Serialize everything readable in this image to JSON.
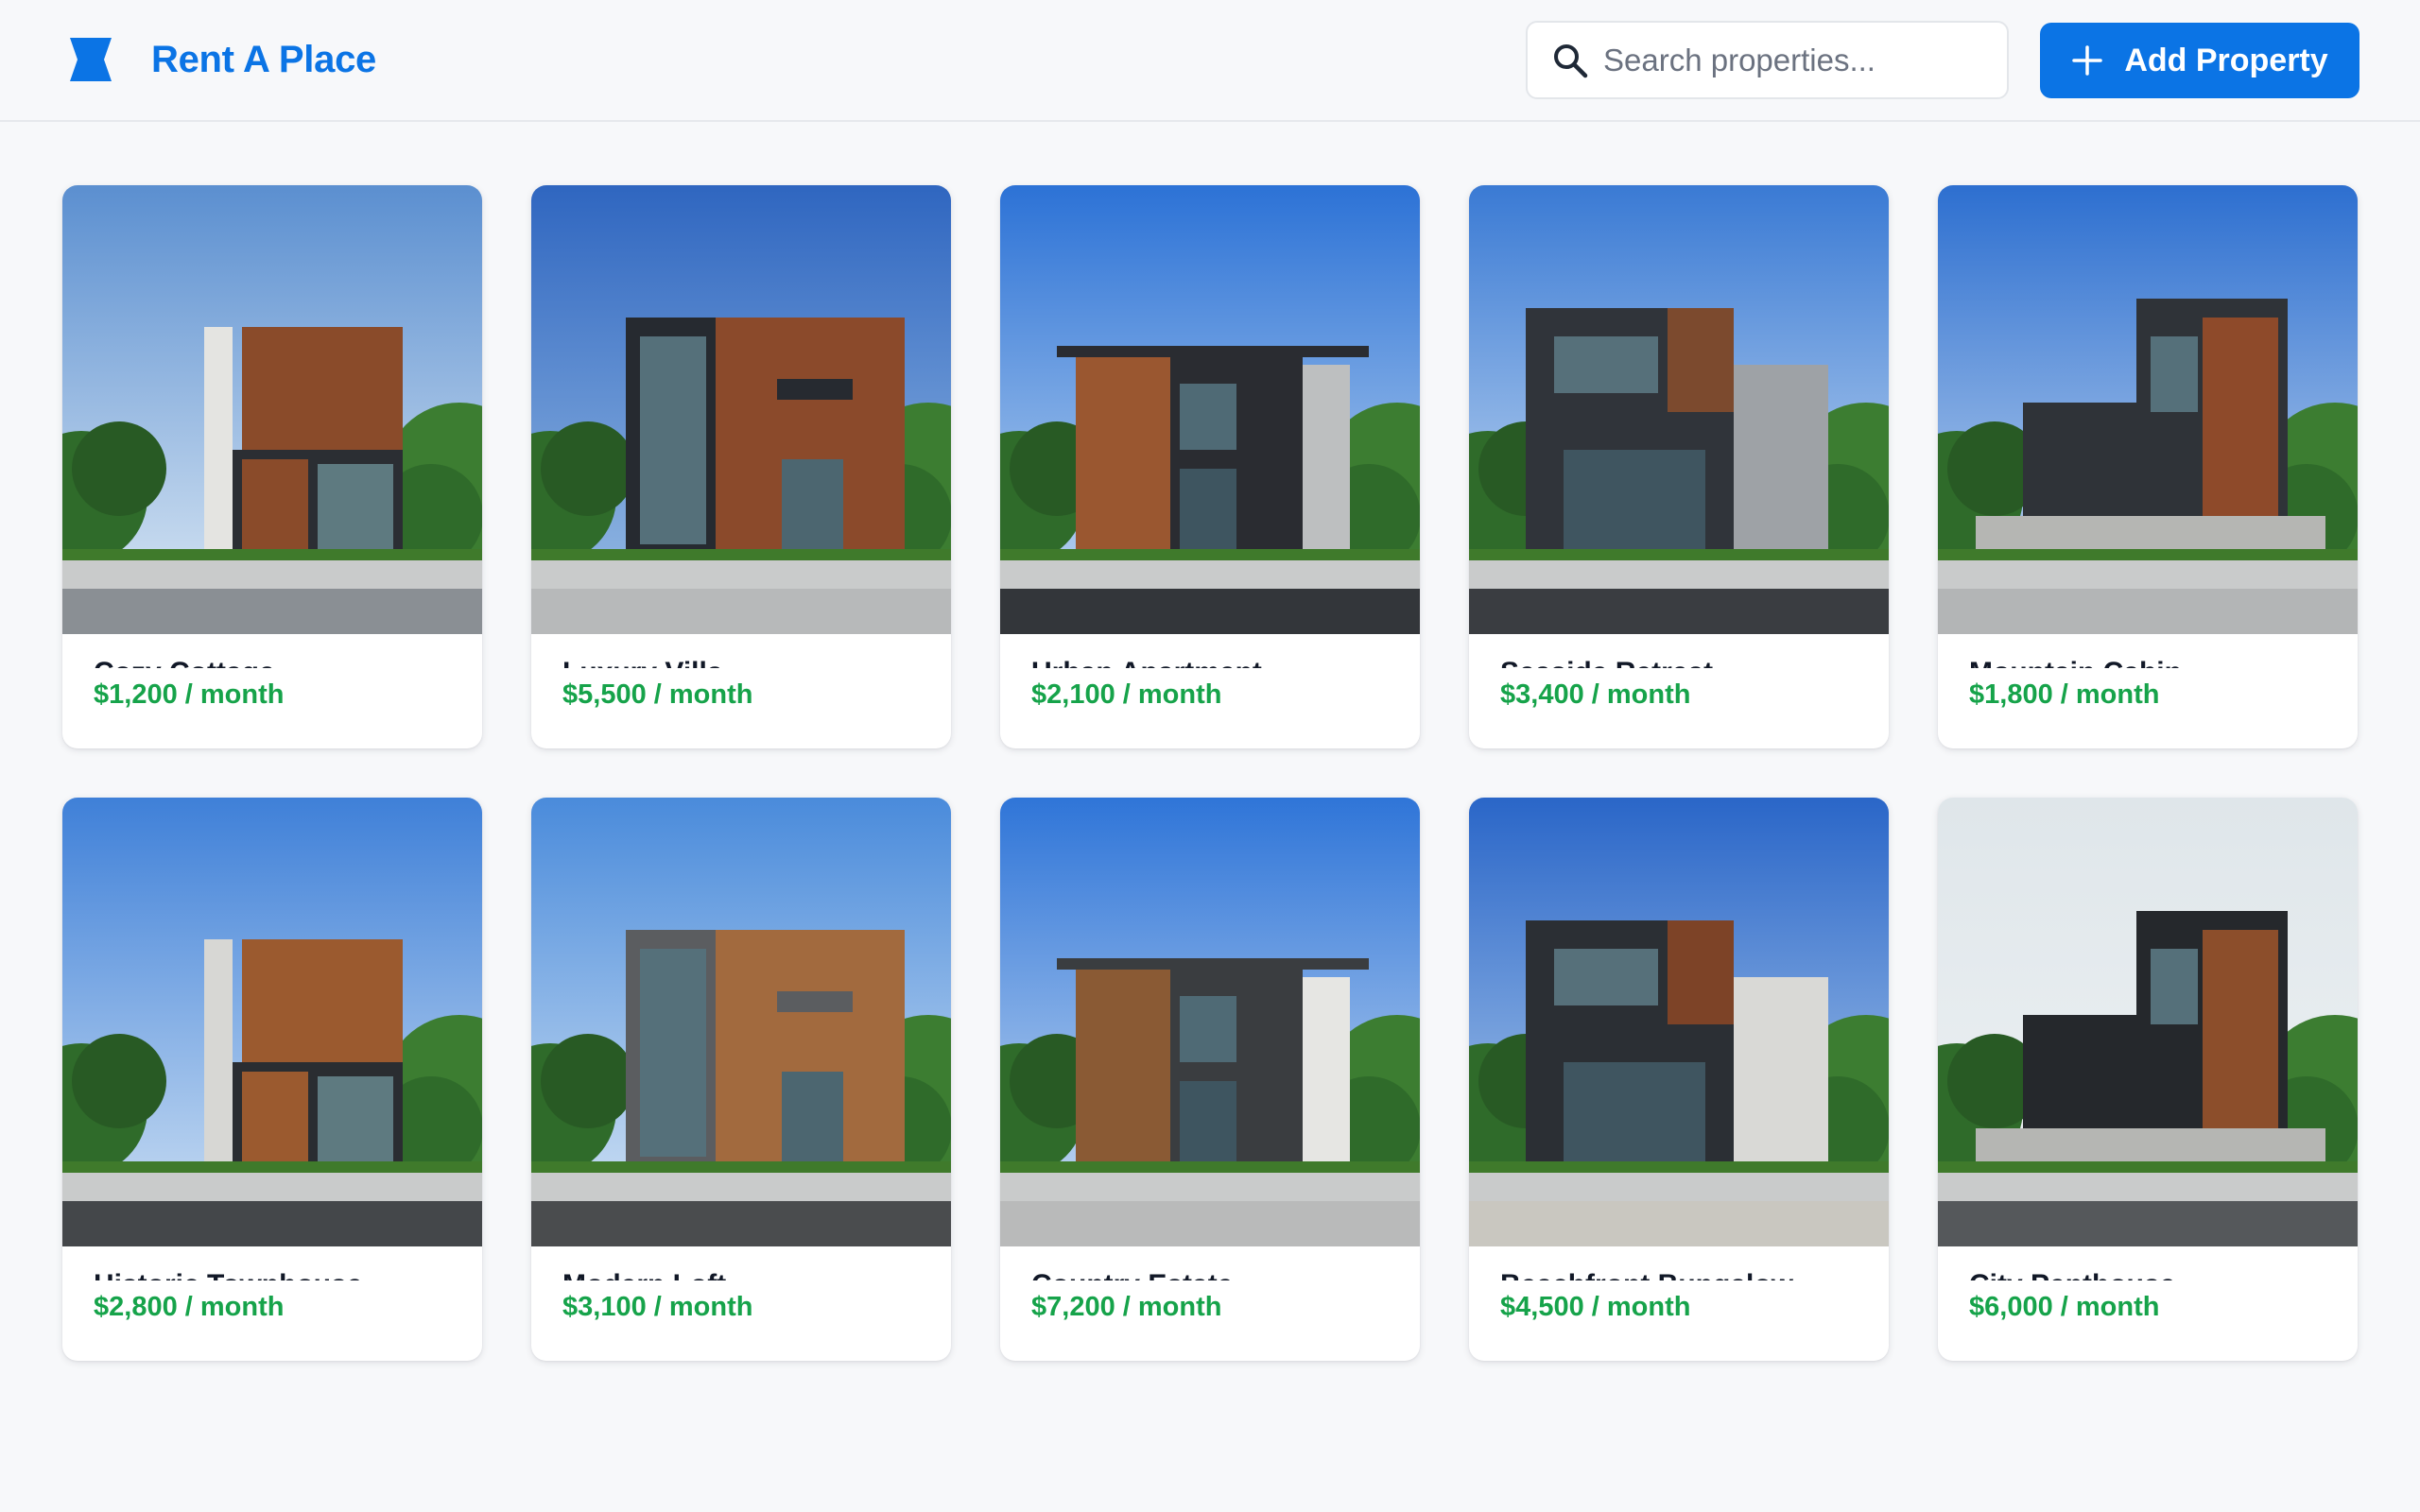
{
  "brand": {
    "name": "Rent A Place",
    "logo_icon": "bookmark-ribbon-icon",
    "color": "#0b74e5"
  },
  "search": {
    "placeholder": "Search properties...",
    "value": "",
    "icon": "search-icon"
  },
  "toolbar": {
    "add_label": "Add Property",
    "add_icon": "plus-icon"
  },
  "colors": {
    "accent": "#0b74e5",
    "price": "#16a34a",
    "background": "#f7f8fa"
  },
  "listings": [
    {
      "title": "Cozy Cottage",
      "price": "$1,200 / month",
      "photo": "modern-house-1"
    },
    {
      "title": "Luxury Villa",
      "price": "$5,500 / month",
      "photo": "modern-house-2"
    },
    {
      "title": "Urban Apartment",
      "price": "$2,100 / month",
      "photo": "modern-house-3"
    },
    {
      "title": "Seaside Retreat",
      "price": "$3,400 / month",
      "photo": "modern-house-4"
    },
    {
      "title": "Mountain Cabin",
      "price": "$1,800 / month",
      "photo": "modern-house-5"
    },
    {
      "title": "Historic Townhouse",
      "price": "$2,800 / month",
      "photo": "modern-house-6"
    },
    {
      "title": "Modern Loft",
      "price": "$3,100 / month",
      "photo": "modern-house-7"
    },
    {
      "title": "Country Estate",
      "price": "$7,200 / month",
      "photo": "modern-house-8"
    },
    {
      "title": "Beachfront Bungalow",
      "price": "$4,500 / month",
      "photo": "modern-house-9"
    },
    {
      "title": "City Penthouse",
      "price": "$6,000 / month",
      "photo": "modern-house-10"
    }
  ]
}
